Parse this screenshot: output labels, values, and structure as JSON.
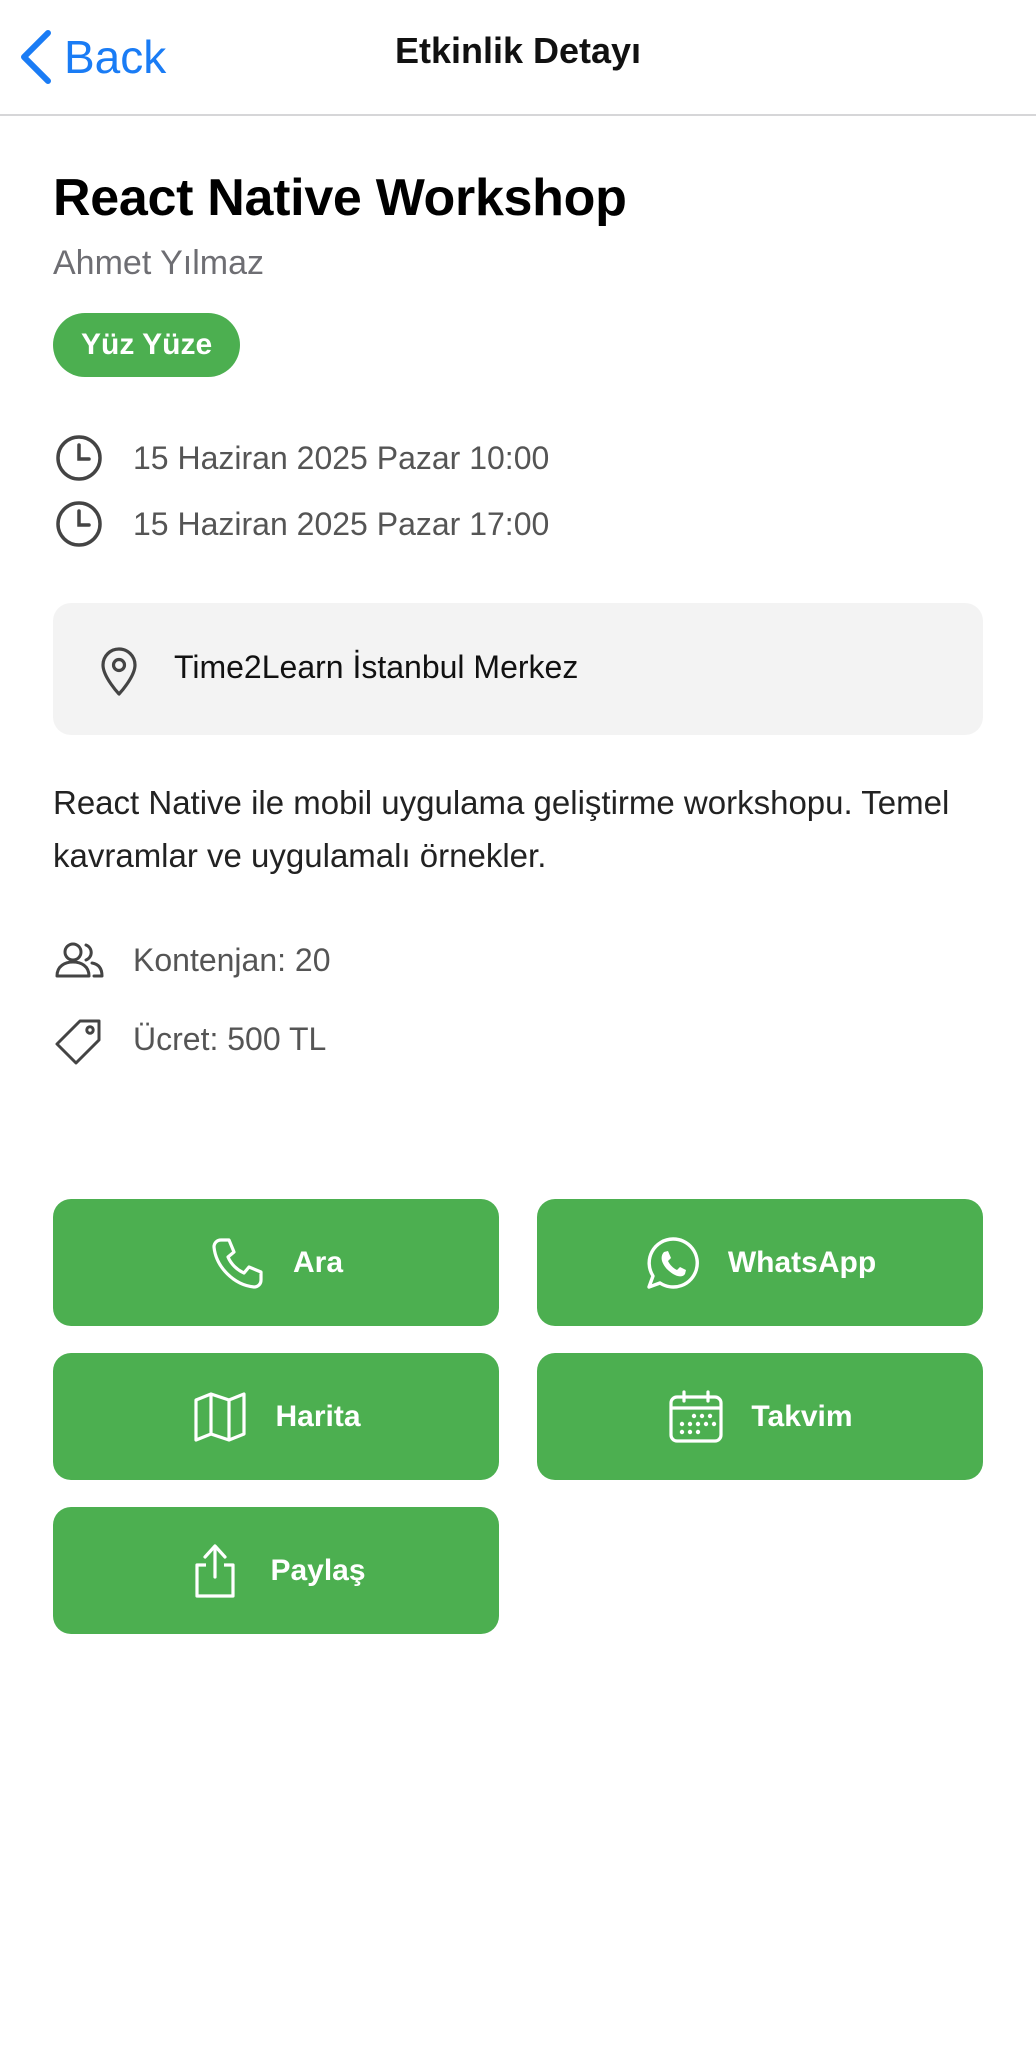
{
  "nav": {
    "back_label": "Back",
    "title": "Etkinlik Detayı"
  },
  "event": {
    "title": "React Native Workshop",
    "organizer": "Ahmet Yılmaz",
    "badge": "Yüz Yüze",
    "start_time": "15 Haziran 2025 Pazar 10:00",
    "end_time": "15 Haziran 2025 Pazar 17:00",
    "location": "Time2Learn İstanbul Merkez",
    "description": "React Native ile mobil uygulama geliştirme workshopu. Temel kavramlar ve uygulamalı örnekler.",
    "capacity": "Kontenjan: 20",
    "fee": "Ücret: 500 TL"
  },
  "actions": {
    "call": "Ara",
    "whatsapp": "WhatsApp",
    "map": "Harita",
    "calendar": "Takvim",
    "share": "Paylaş"
  },
  "colors": {
    "accent_green": "#4caf50",
    "link_blue": "#1a7cf5",
    "card_gray": "#f3f3f3"
  }
}
